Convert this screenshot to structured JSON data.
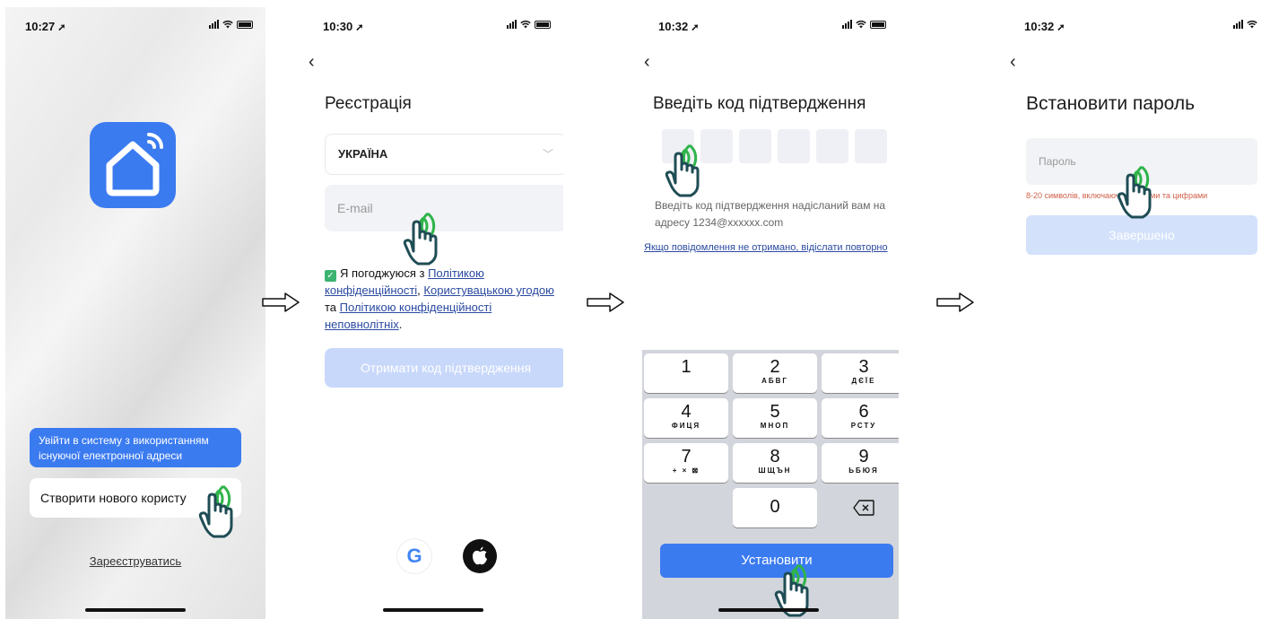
{
  "colors": {
    "accent": "#3b7bf0",
    "accent_disabled": "#c8d8fb",
    "hand_outline": "#1f4d55",
    "tap_ring": "#2fb44a"
  },
  "screen1": {
    "time": "10:27",
    "login_button": "Увійти в систему з використанням існуючої електронної адреси",
    "create_button": "Створити нового користу",
    "register_link": "Зареєструватись"
  },
  "screen2": {
    "time": "10:30",
    "title": "Реєстрація",
    "country": "УКРАЇНА",
    "email_placeholder": "E-mail",
    "agree": {
      "prefix": "Я погоджуюся з ",
      "link1": "Політикою конфіденційності",
      "sep": ", ",
      "link2": "Користувацькою угодою",
      "and": " та ",
      "link3": "Політикою конфіденційності неповнолітніх",
      "end": "."
    },
    "get_code_button": "Отримати код підтвердження",
    "google_label": "G"
  },
  "screen3": {
    "time": "10:32",
    "title": "Введіть код  підтвердження",
    "hint": "Введіть код підтвердження надісланий вам на адресу 1234@xxxxxx.com",
    "resend_link": "Якщо повідомлення не отримано, відіслати повторно",
    "keys": [
      {
        "digit": "1",
        "letters": ""
      },
      {
        "digit": "2",
        "letters": "АБВГ"
      },
      {
        "digit": "3",
        "letters": "ДЄЇЕ"
      },
      {
        "digit": "4",
        "letters": "ФИЦЯ"
      },
      {
        "digit": "5",
        "letters": "МНОП"
      },
      {
        "digit": "6",
        "letters": "РСТУ"
      },
      {
        "digit": "7",
        "letters": "+ × ⊠"
      },
      {
        "digit": "8",
        "letters": "ШЩЪН"
      },
      {
        "digit": "9",
        "letters": "ЬБЮЯ"
      },
      {
        "digit": "0",
        "letters": ""
      }
    ],
    "set_button": "Установити"
  },
  "screen4": {
    "time": "10:32",
    "title": "Встановити пароль",
    "password_placeholder": "Пароль",
    "rule": "8-20 символів, включаючи літерами та цифрами",
    "done_button": "Завершено"
  }
}
